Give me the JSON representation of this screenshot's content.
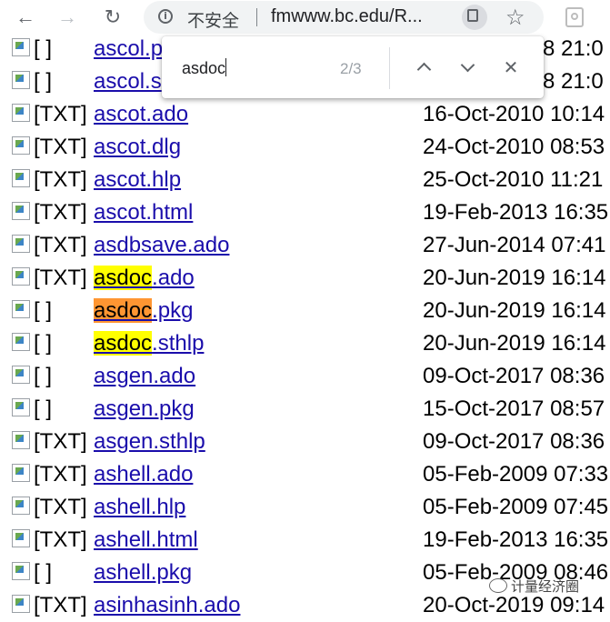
{
  "toolbar": {
    "back_glyph": "←",
    "forward_glyph": "→",
    "reload_glyph": "↻",
    "security_label": "不安全",
    "url": "fmwww.bc.edu/R...",
    "star_glyph": "☆",
    "icons": [
      "back-arrow-icon",
      "forward-arrow-icon",
      "reload-icon",
      "info-icon",
      "find-icon",
      "star-icon",
      "extension-icon"
    ]
  },
  "find_bar": {
    "query": "asdoc",
    "count": "2/3",
    "close_glyph": "✕"
  },
  "listing": {
    "rows": [
      {
        "alt": "[ ]",
        "pre": "",
        "match": "",
        "name": "ascol.p",
        "date": "8 21:0"
      },
      {
        "alt": "[ ]",
        "pre": "",
        "match": "",
        "name": "ascol.s",
        "date": "8 21:0"
      },
      {
        "alt": "[TXT]",
        "pre": "",
        "match": "",
        "name": "ascot.ado",
        "date": "16-Oct-2010 10:14"
      },
      {
        "alt": "[TXT]",
        "pre": "",
        "match": "",
        "name": "ascot.dlg",
        "date": "24-Oct-2010 08:53"
      },
      {
        "alt": "[TXT]",
        "pre": "",
        "match": "",
        "name": "ascot.hlp",
        "date": "25-Oct-2010 11:21"
      },
      {
        "alt": "[TXT]",
        "pre": "",
        "match": "",
        "name": "ascot.html",
        "date": "19-Feb-2013 16:35"
      },
      {
        "alt": "[TXT]",
        "pre": "",
        "match": "",
        "name": "asdbsave.ado",
        "date": "27-Jun-2014 07:41"
      },
      {
        "alt": "[TXT]",
        "pre": "",
        "match": "asdoc",
        "name": ".ado",
        "date": "20-Jun-2019 16:14",
        "active": false
      },
      {
        "alt": "[ ]",
        "pre": "",
        "match": "asdoc",
        "name": ".pkg",
        "date": "20-Jun-2019 16:14",
        "active": true
      },
      {
        "alt": "[ ]",
        "pre": "",
        "match": "asdoc",
        "name": ".sthlp",
        "date": "20-Jun-2019 16:14",
        "active": false
      },
      {
        "alt": "[ ]",
        "pre": "",
        "match": "",
        "name": "asgen.ado",
        "date": "09-Oct-2017 08:36"
      },
      {
        "alt": "[ ]",
        "pre": "",
        "match": "",
        "name": "asgen.pkg",
        "date": "15-Oct-2017 08:57"
      },
      {
        "alt": "[TXT]",
        "pre": "",
        "match": "",
        "name": "asgen.sthlp",
        "date": "09-Oct-2017 08:36"
      },
      {
        "alt": "[TXT]",
        "pre": "",
        "match": "",
        "name": "ashell.ado",
        "date": "05-Feb-2009 07:33"
      },
      {
        "alt": "[TXT]",
        "pre": "",
        "match": "",
        "name": "ashell.hlp",
        "date": "05-Feb-2009 07:45"
      },
      {
        "alt": "[TXT]",
        "pre": "",
        "match": "",
        "name": "ashell.html",
        "date": "19-Feb-2013 16:35"
      },
      {
        "alt": "[ ]",
        "pre": "",
        "match": "",
        "name": "ashell.pkg",
        "date": "05-Feb-2009 08:46"
      },
      {
        "alt": "[TXT]",
        "pre": "",
        "match": "",
        "name": "asinhasinh.ado",
        "date": "20-Oct-2019 09:14"
      }
    ]
  },
  "watermark": {
    "text": "计量经济圈"
  },
  "colors": {
    "link": "#1a0dab",
    "highlight": "#ffff00",
    "active_highlight": "#ff9632"
  }
}
